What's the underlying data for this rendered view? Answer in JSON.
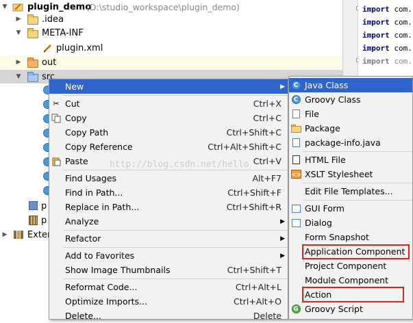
{
  "project_tree": {
    "root": {
      "name": "plugin_demo",
      "path": "(D:\\studio_workspace\\plugin_demo)"
    },
    "items": [
      {
        "label": ".idea",
        "icon": "folder-icon"
      },
      {
        "label": "META-INF",
        "icon": "folder-icon"
      },
      {
        "label": "plugin.xml",
        "icon": "xml-file-icon"
      },
      {
        "label": "out",
        "icon": "folder-orange-icon"
      },
      {
        "label": "src",
        "icon": "source-folder-icon"
      },
      {
        "label": "p",
        "icon": "package-icon"
      },
      {
        "label": "p",
        "icon": "library-icon"
      },
      {
        "label": "Exter",
        "icon": "external-libraries-icon"
      }
    ]
  },
  "editor": {
    "lines": [
      {
        "kw": "import",
        "pkg": "com.i"
      },
      {
        "kw": "import",
        "pkg": "com.i"
      },
      {
        "kw": "import",
        "pkg": "com.i"
      },
      {
        "kw": "import",
        "pkg": "com.i"
      },
      {
        "kw": "import",
        "pkg": "com.i"
      }
    ]
  },
  "context_menu": {
    "items": [
      {
        "label": "New",
        "shortcut": "",
        "has_submenu": true
      },
      {
        "label": "Cut",
        "shortcut": "Ctrl+X"
      },
      {
        "label": "Copy",
        "shortcut": "Ctrl+C"
      },
      {
        "label": "Copy Path",
        "shortcut": "Ctrl+Shift+C"
      },
      {
        "label": "Copy Reference",
        "shortcut": "Ctrl+Alt+Shift+C"
      },
      {
        "label": "Paste",
        "shortcut": "Ctrl+V"
      },
      {
        "label": "Find Usages",
        "shortcut": "Alt+F7"
      },
      {
        "label": "Find in Path...",
        "shortcut": "Ctrl+Shift+F"
      },
      {
        "label": "Replace in Path...",
        "shortcut": "Ctrl+Shift+R"
      },
      {
        "label": "Analyze",
        "shortcut": "",
        "has_submenu": true
      },
      {
        "label": "Refactor",
        "shortcut": "",
        "has_submenu": true
      },
      {
        "label": "Add to Favorites",
        "shortcut": "",
        "has_submenu": true
      },
      {
        "label": "Show Image Thumbnails",
        "shortcut": "Ctrl+Shift+T"
      },
      {
        "label": "Reformat Code...",
        "shortcut": "Ctrl+Alt+L"
      },
      {
        "label": "Optimize Imports...",
        "shortcut": "Ctrl+Alt+O"
      },
      {
        "label": "Delete...",
        "shortcut": "Delete"
      }
    ]
  },
  "submenu": {
    "items": [
      {
        "label": "Java Class"
      },
      {
        "label": "Groovy Class"
      },
      {
        "label": "File"
      },
      {
        "label": "Package"
      },
      {
        "label": "package-info.java"
      },
      {
        "label": "HTML File"
      },
      {
        "label": "XSLT Stylesheet"
      },
      {
        "label": "Edit File Templates..."
      },
      {
        "label": "GUI Form"
      },
      {
        "label": "Dialog"
      },
      {
        "label": "Form Snapshot"
      },
      {
        "label": "Application Component"
      },
      {
        "label": "Project Component"
      },
      {
        "label": "Module Component"
      },
      {
        "label": "Action"
      },
      {
        "label": "Groovy Script"
      }
    ]
  },
  "watermark": "http://blog.csdn.net/hello"
}
